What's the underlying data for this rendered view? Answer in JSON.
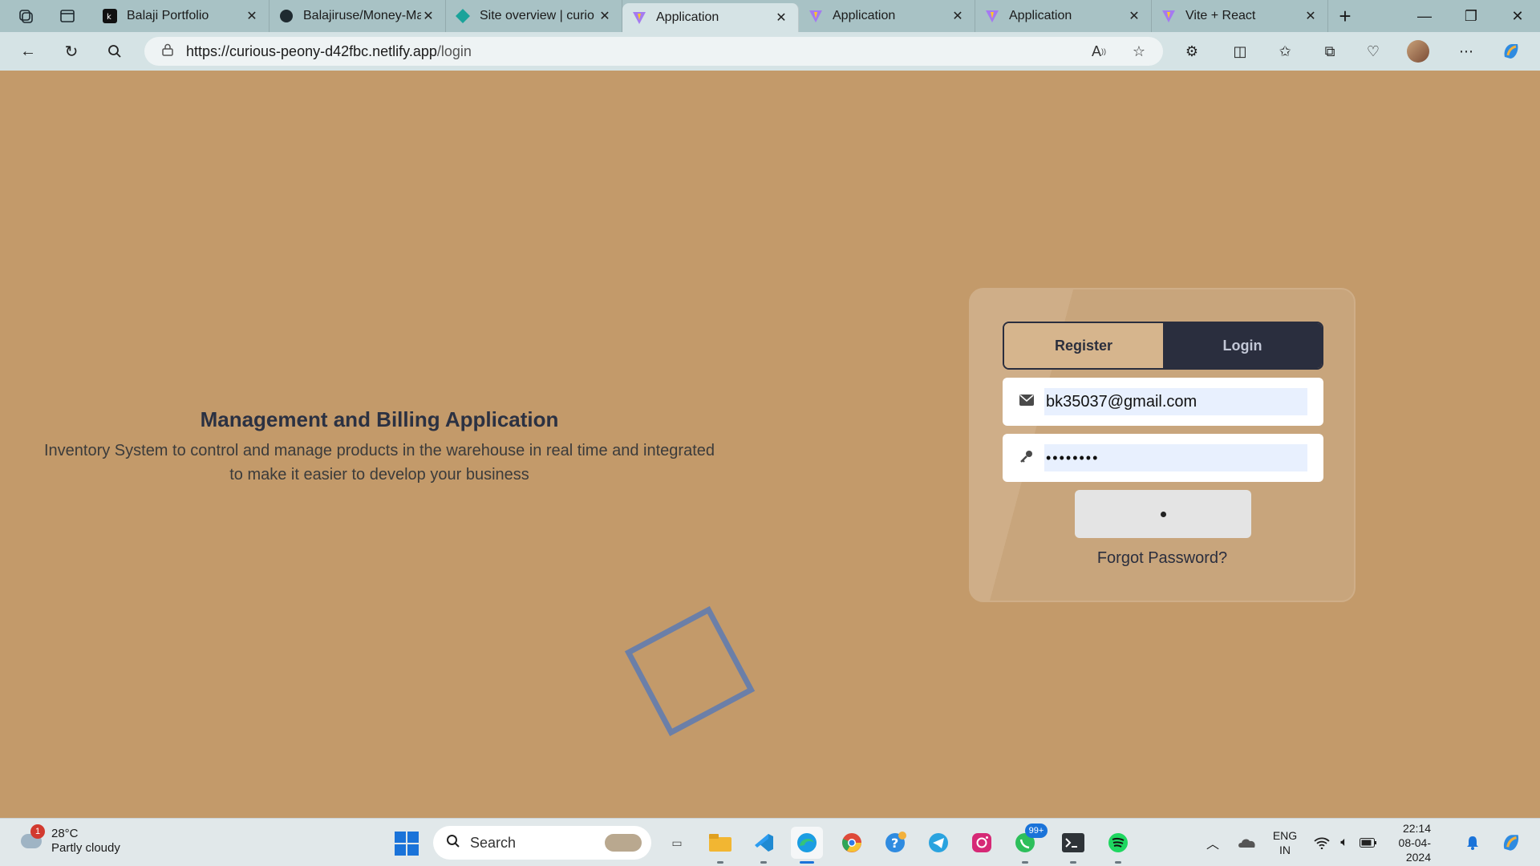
{
  "browser": {
    "tabs": [
      {
        "title": "Balaji Portfolio",
        "favicon": "portfolio-icon",
        "active": false
      },
      {
        "title": "Balajiruse/Money-Ma",
        "favicon": "github-icon",
        "active": false
      },
      {
        "title": "Site overview | curio",
        "favicon": "netlify-icon",
        "active": false
      },
      {
        "title": "Application",
        "favicon": "vite-icon",
        "active": true
      },
      {
        "title": "Application",
        "favicon": "vite-icon",
        "active": false
      },
      {
        "title": "Application",
        "favicon": "vite-icon",
        "active": false
      },
      {
        "title": "Vite + React",
        "favicon": "vite-icon",
        "active": false
      }
    ],
    "url_host": "https://curious-peony-d42fbc.netlify.app",
    "url_path": "/login"
  },
  "hero": {
    "title": "Management and Billing Application",
    "subtitle_line1": "Inventory System to control and manage products in the warehouse in real time and integrated",
    "subtitle_line2": "to make it easier to develop your business"
  },
  "auth": {
    "register_tab": "Register",
    "login_tab": "Login",
    "selected_tab": "Login",
    "email_value": "bk35037@gmail.com",
    "password_value": "••••••••",
    "forgot_link": "Forgot Password?"
  },
  "colors": {
    "page_bg": "#c39a6a",
    "dark_accent": "#2a2e3e",
    "decor_square": "#6b7fa8"
  },
  "taskbar": {
    "weather_temp": "28°C",
    "weather_condition": "Partly cloudy",
    "weather_badge": "1",
    "search_placeholder": "Search",
    "whatsapp_badge": "99+",
    "lang_line1": "ENG",
    "lang_line2": "IN",
    "time": "22:14",
    "date": "08-04-2024"
  }
}
